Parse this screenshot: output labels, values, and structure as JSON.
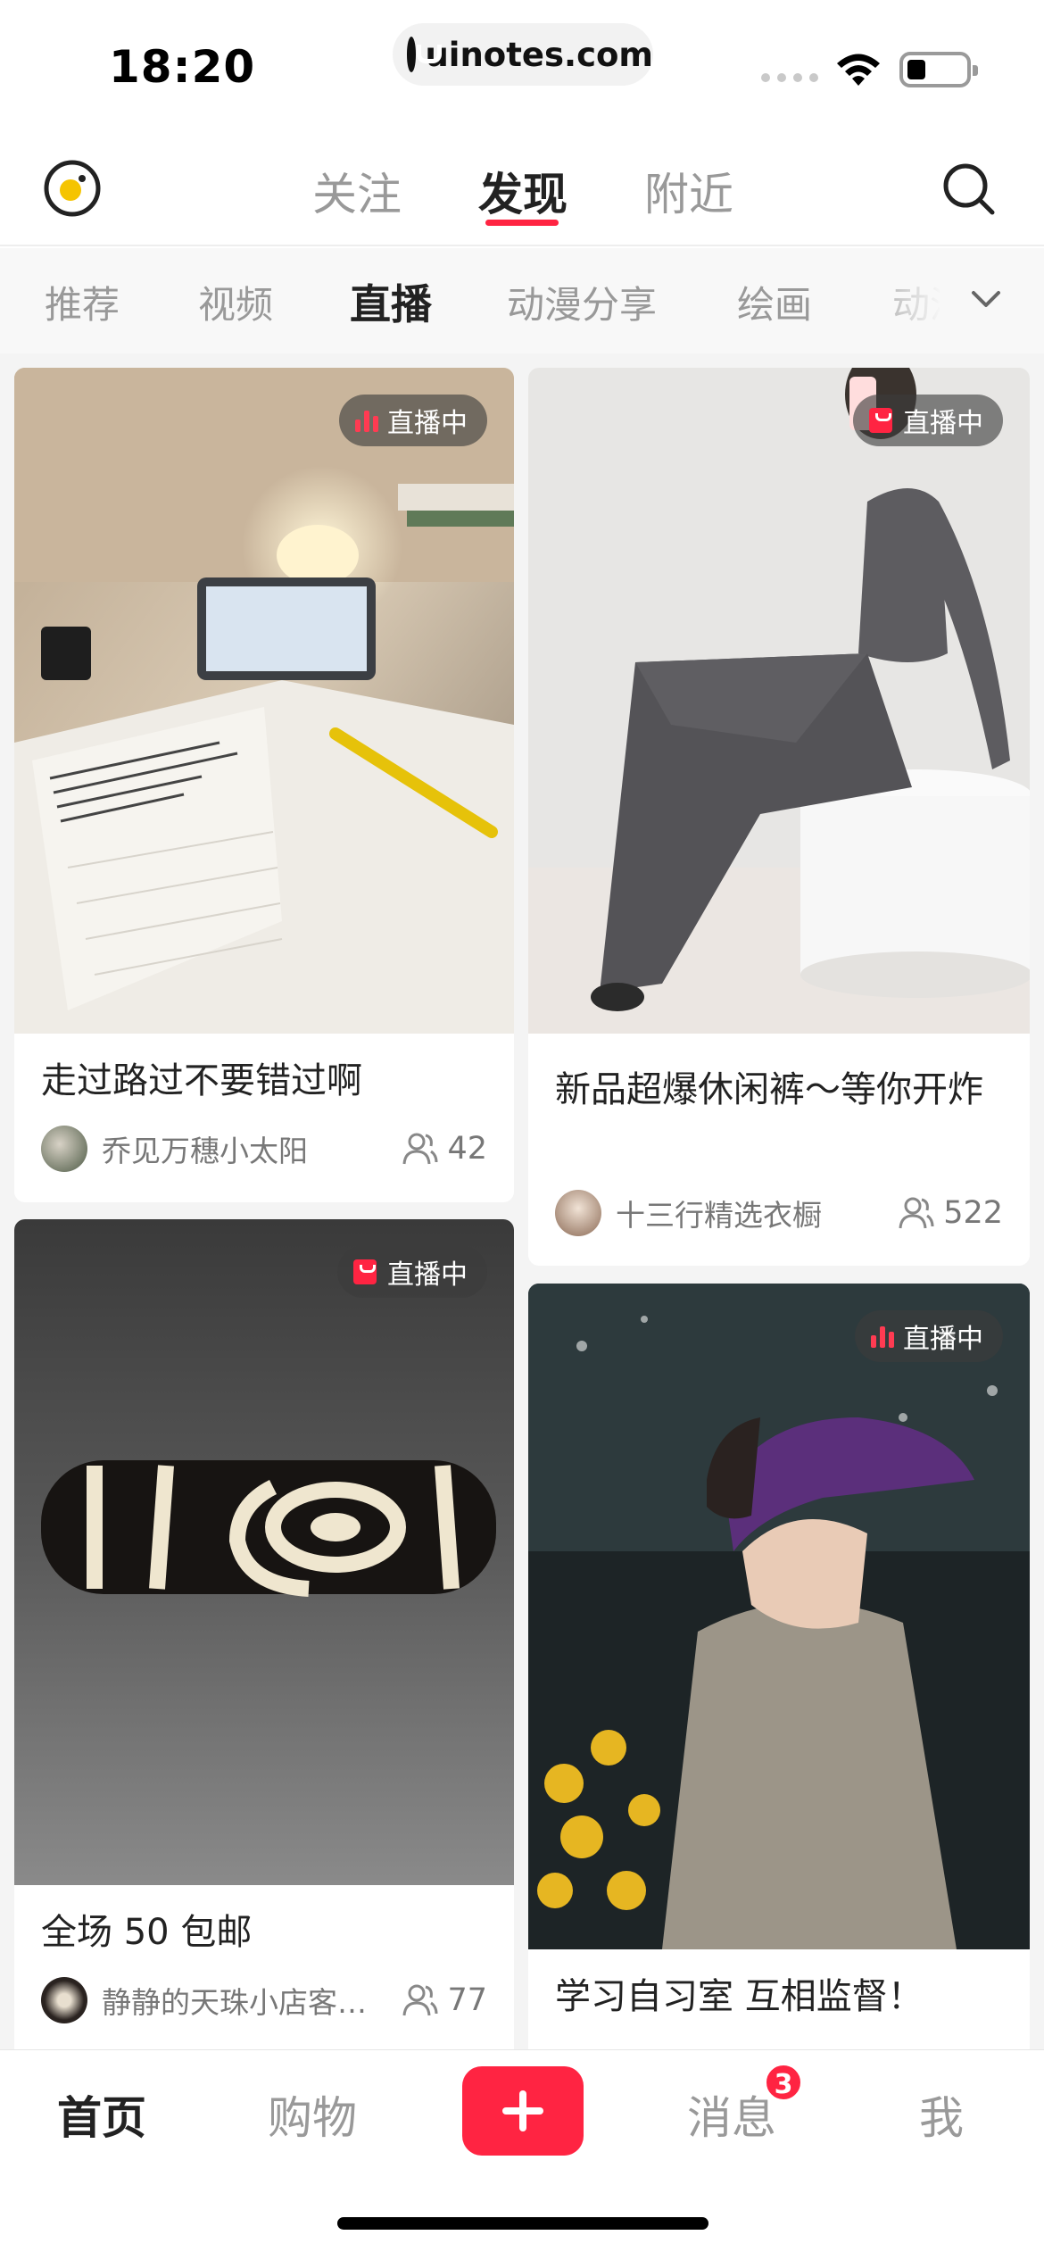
{
  "status_bar": {
    "time": "18:20",
    "url": "uinotes.com"
  },
  "top_nav": {
    "tabs": [
      "关注",
      "发现",
      "附近"
    ],
    "active_tab": "发现"
  },
  "categories": {
    "items": [
      "推荐",
      "视频",
      "直播",
      "动漫分享",
      "绘画",
      "动漫"
    ],
    "active": "直播"
  },
  "cards": [
    {
      "title": "走过路过不要错过啊",
      "author": "乔见万穗小太阳",
      "viewers": "42",
      "badge": "直播中",
      "badge_icon": "live-bars-icon"
    },
    {
      "title": "新品超爆休闲裤～等你开炸",
      "author": "十三行精选衣橱",
      "viewers": "522",
      "badge": "直播中",
      "badge_icon": "shopping-bag-icon"
    },
    {
      "title": "全场 50 包邮",
      "author": "静静的天珠小店客…",
      "viewers": "77",
      "badge": "直播中",
      "badge_icon": "shopping-bag-icon"
    },
    {
      "title": "学习自习室 互相监督！",
      "author": "",
      "viewers": "",
      "badge": "直播中",
      "badge_icon": "live-bars-icon"
    }
  ],
  "tab_bar": {
    "home": "首页",
    "shopping": "购物",
    "messages": "消息",
    "messages_badge": "3",
    "me": "我"
  },
  "colors": {
    "accent": "#ff2442",
    "text_primary": "#222222",
    "text_secondary": "#999999",
    "feed_background": "#f4f4f4"
  }
}
